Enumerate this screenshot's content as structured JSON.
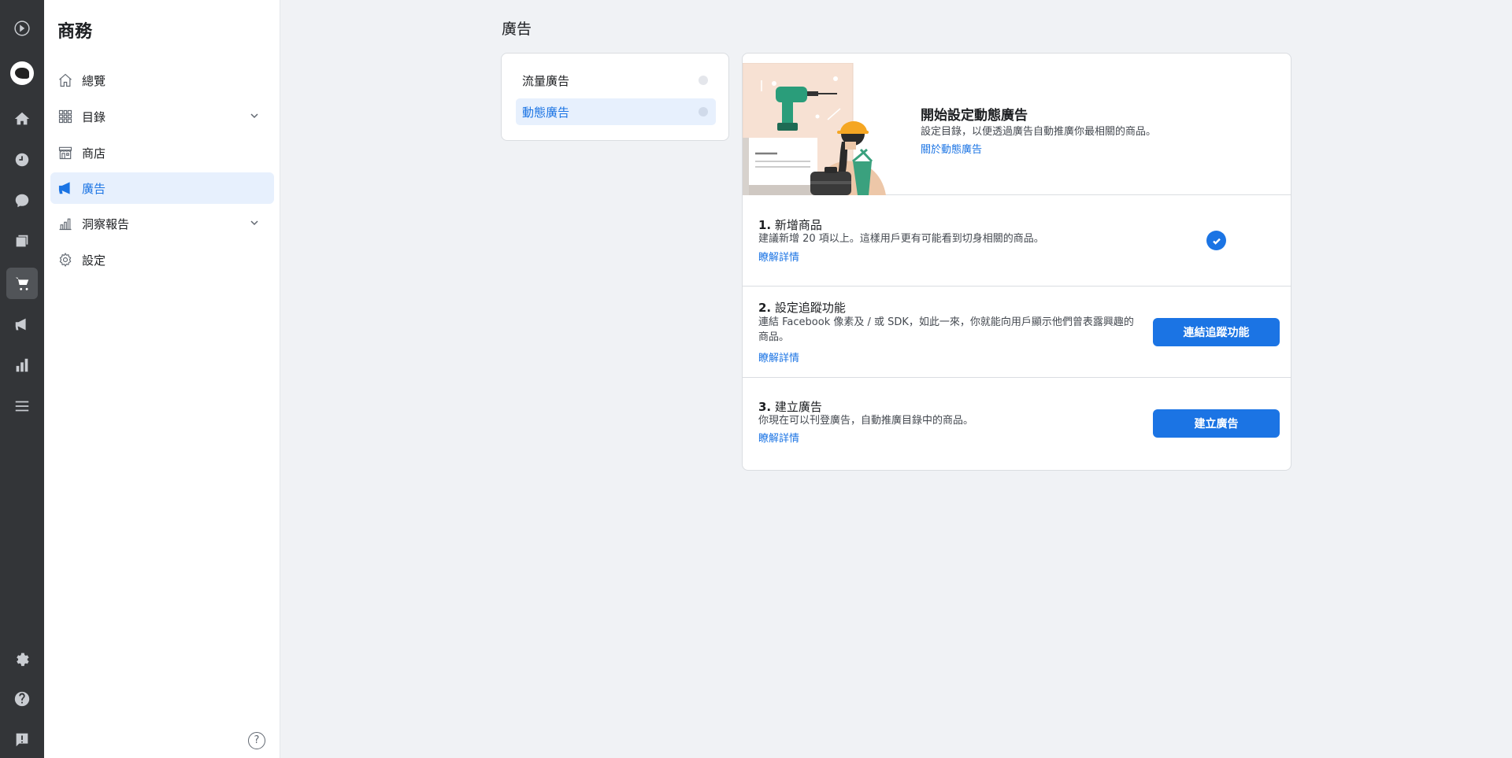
{
  "sidebar": {
    "title": "商務",
    "items": [
      {
        "label": "總覽"
      },
      {
        "label": "目錄"
      },
      {
        "label": "商店"
      },
      {
        "label": "廣告"
      },
      {
        "label": "洞察報告"
      },
      {
        "label": "設定"
      }
    ],
    "help_symbol": "?"
  },
  "page": {
    "title": "廣告"
  },
  "tabs": [
    {
      "label": "流量廣告"
    },
    {
      "label": "動態廣告"
    }
  ],
  "hero": {
    "title": "開始設定動態廣告",
    "description": "設定目錄，以便透過廣告自動推廣你最相關的商品。",
    "link": "關於動態廣告"
  },
  "steps": [
    {
      "number": "1.",
      "title": "新增商品",
      "description": "建議新增 20 項以上。這樣用戶更有可能看到切身相關的商品。",
      "link": "瞭解詳情",
      "status": "completed"
    },
    {
      "number": "2.",
      "title": "設定追蹤功能",
      "description": "連結 Facebook 像素及 / 或 SDK，如此一來，你就能向用戶顯示他們曾表露興趣的商品。",
      "link": "瞭解詳情",
      "button": "連結追蹤功能"
    },
    {
      "number": "3.",
      "title": "建立廣告",
      "description": "你現在可以刊登廣告，自動推廣目錄中的商品。",
      "link": "瞭解詳情",
      "button": "建立廣告"
    }
  ],
  "colors": {
    "accent": "#1b74e4",
    "rail": "#333538",
    "background": "#f0f2f5"
  }
}
